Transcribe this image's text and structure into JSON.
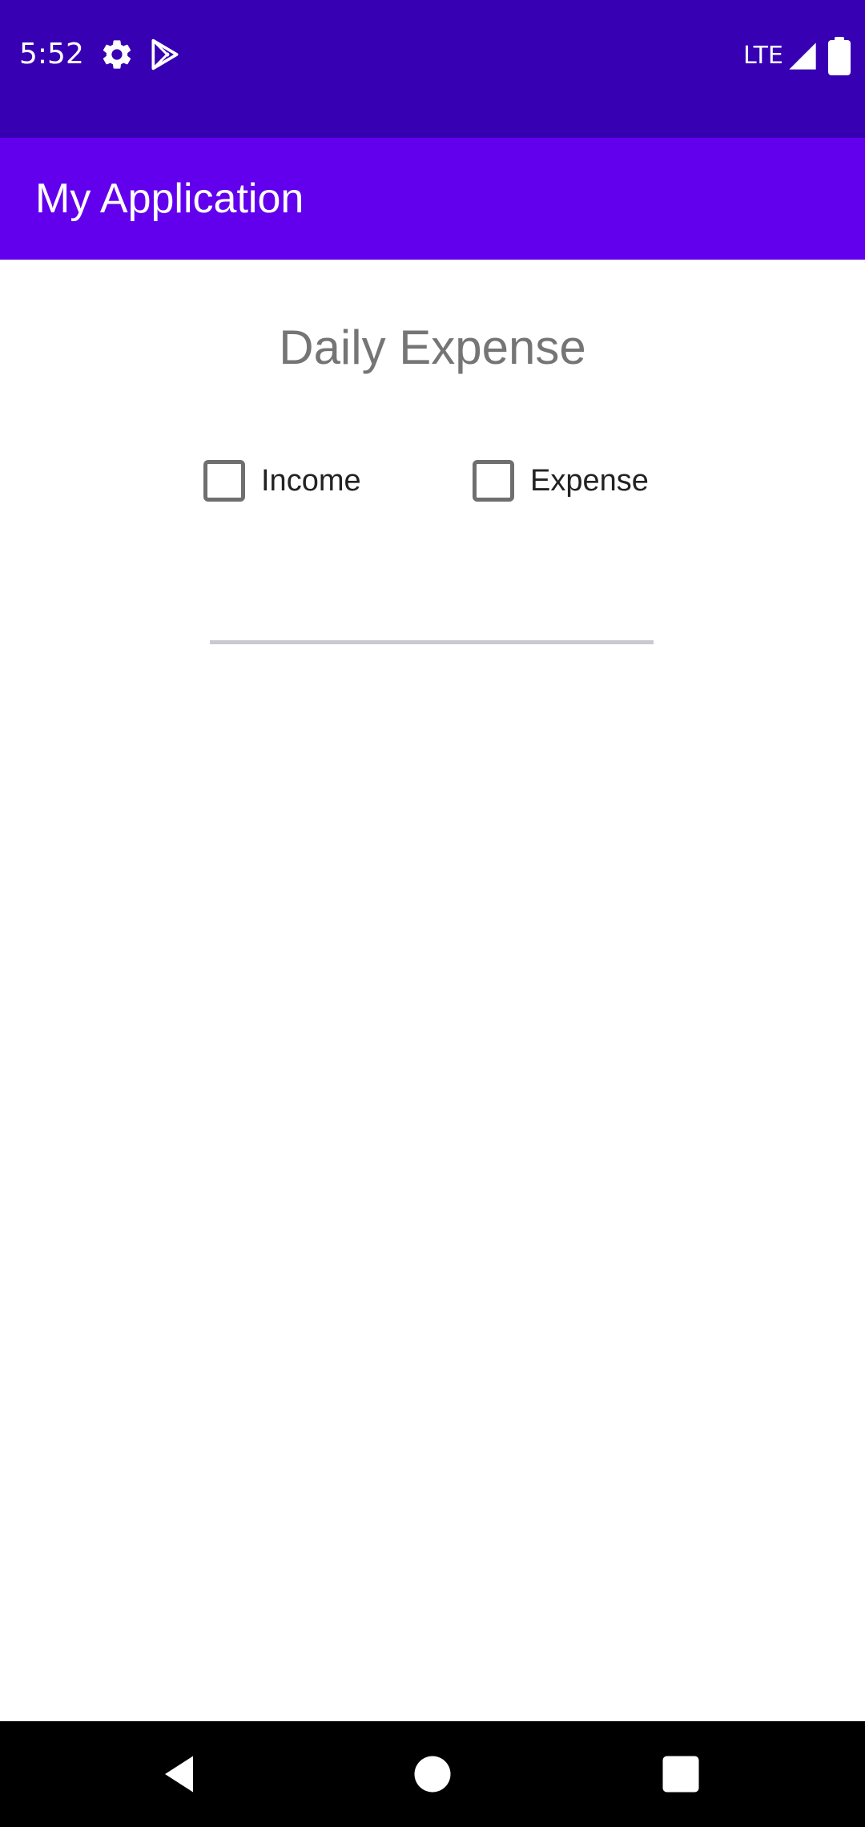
{
  "status_bar": {
    "time": "5:52",
    "network": "LTE",
    "icons": [
      "gear-icon",
      "play-store-icon",
      "signal-icon",
      "battery-icon"
    ]
  },
  "app_bar": {
    "title": "My Application"
  },
  "main": {
    "title": "Daily Expense",
    "checkboxes": [
      {
        "label": "Income",
        "checked": false
      },
      {
        "label": "Expense",
        "checked": false
      }
    ],
    "amount_input": {
      "value": "",
      "placeholder": ""
    }
  },
  "nav_bar": {
    "icons": [
      "back-icon",
      "home-icon",
      "recents-icon"
    ]
  },
  "colors": {
    "status_bar": "#3700b3",
    "app_bar": "#6200ee",
    "title_text": "#757575",
    "checkbox_border": "#6f6f6f",
    "input_underline": "#c9c9cf",
    "nav_bar": "#000000"
  }
}
